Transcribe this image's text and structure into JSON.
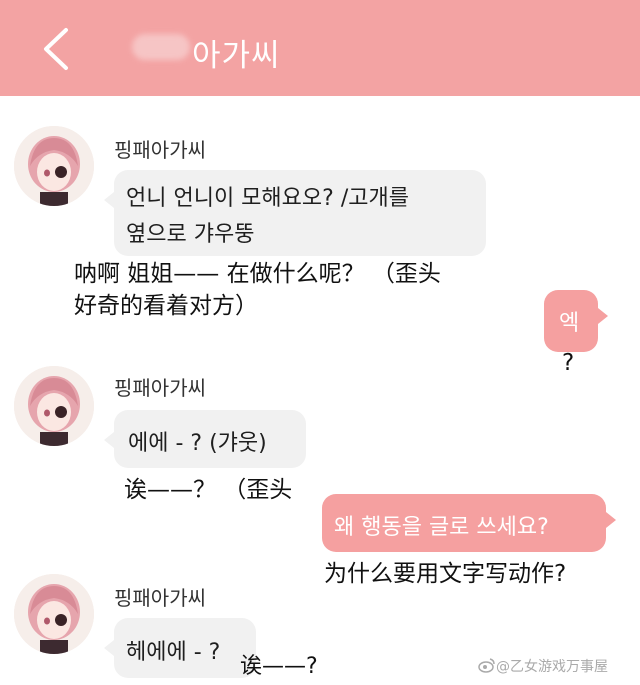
{
  "header": {
    "title": "아가씨",
    "back_icon": "chevron-left-icon",
    "color": "#f3a3a3"
  },
  "messages": [
    {
      "sender": "핑패아가씨",
      "text": [
        "언니 언니이 모해요오? /고개를",
        "옆으로 갸우뚱"
      ],
      "translation": [
        "呐啊 姐姐—— 在做什么呢？ （歪头",
        "好奇的看着对方）"
      ]
    },
    {
      "self_text": "엑",
      "translation": "?"
    },
    {
      "sender": "핑패아가씨",
      "text": [
        "에에 - ? (갸웃)"
      ],
      "translation": "诶——？ （歪头"
    },
    {
      "self_text": "왜 행동을 글로 쓰세요?",
      "translation": "为什么要用文字写动作?"
    },
    {
      "sender": "핑패아가씨",
      "text": [
        "헤에에 - ?"
      ],
      "translation": "诶——?"
    }
  ],
  "watermark": "@乙女游戏万事屋",
  "colors": {
    "incoming_bubble": "#f1f1f1",
    "outgoing_bubble": "#f5a0a0"
  }
}
